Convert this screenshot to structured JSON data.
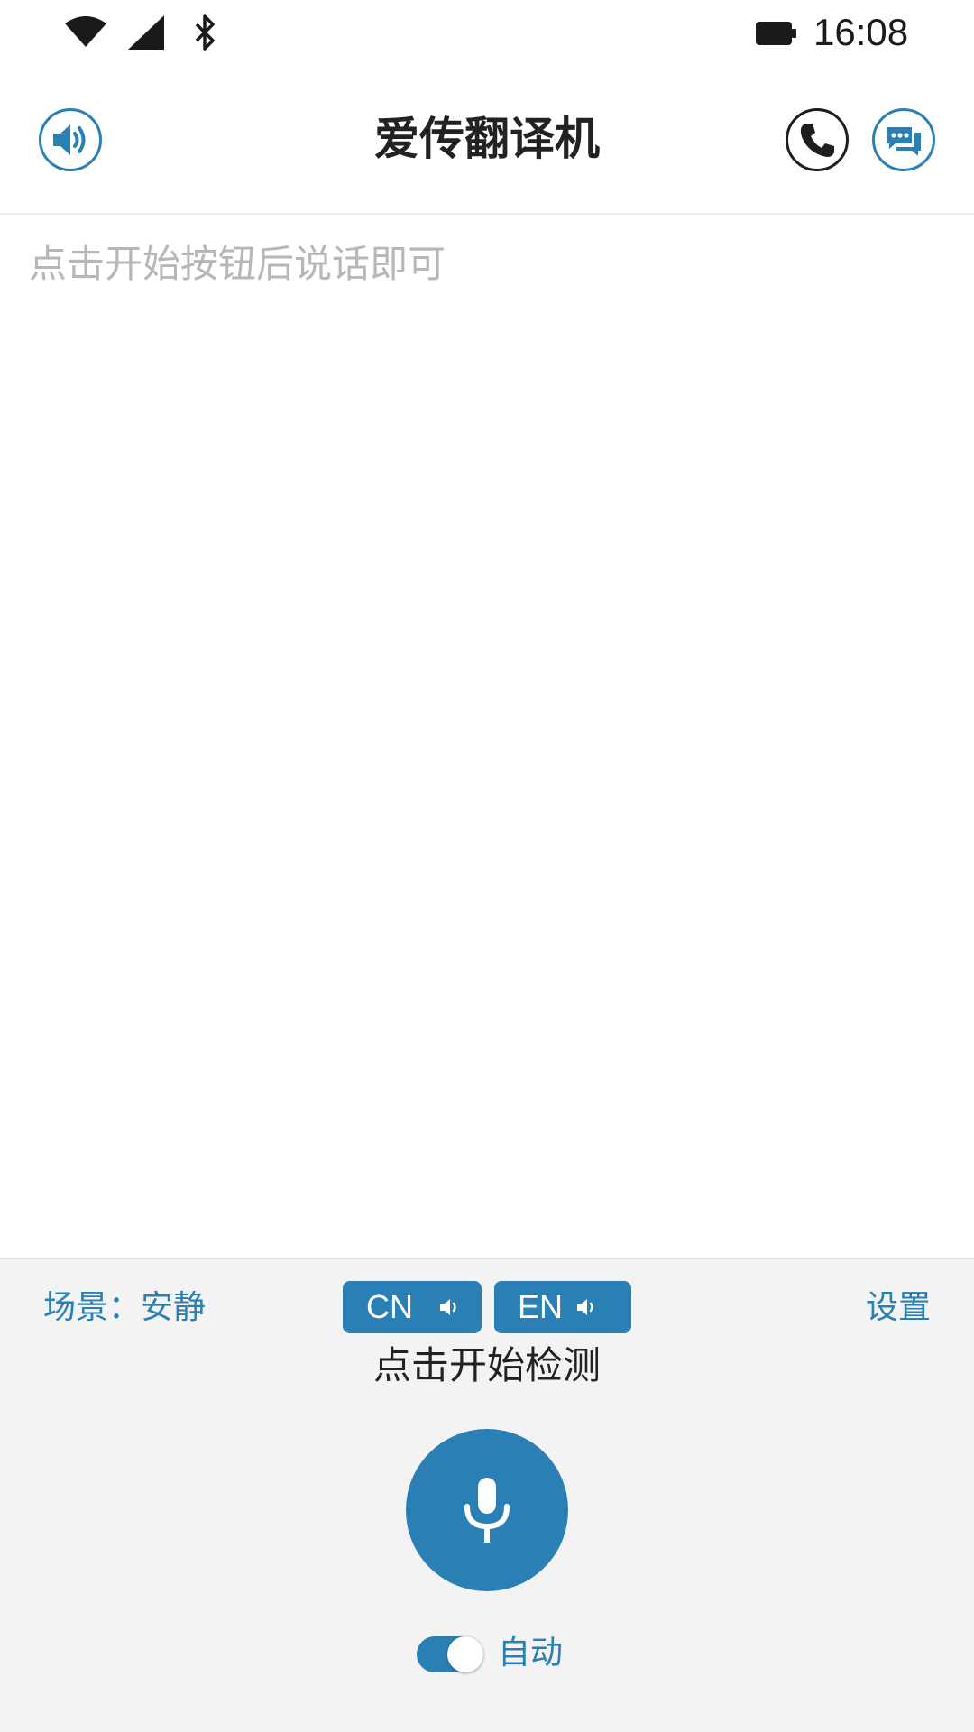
{
  "status_bar": {
    "time": "16:08"
  },
  "app_bar": {
    "title": "爱传翻译机"
  },
  "content": {
    "placeholder": "点击开始按钮后说话即可"
  },
  "bottom": {
    "scene_label": "场景：安静",
    "settings_label": "设置",
    "source_lang": "CN",
    "target_lang": "EN",
    "start_detect_label": "点击开始检测",
    "auto_label": "自动",
    "auto_enabled": true
  },
  "colors": {
    "accent": "#2a7fb4",
    "hint_text": "#b7b7b7"
  }
}
